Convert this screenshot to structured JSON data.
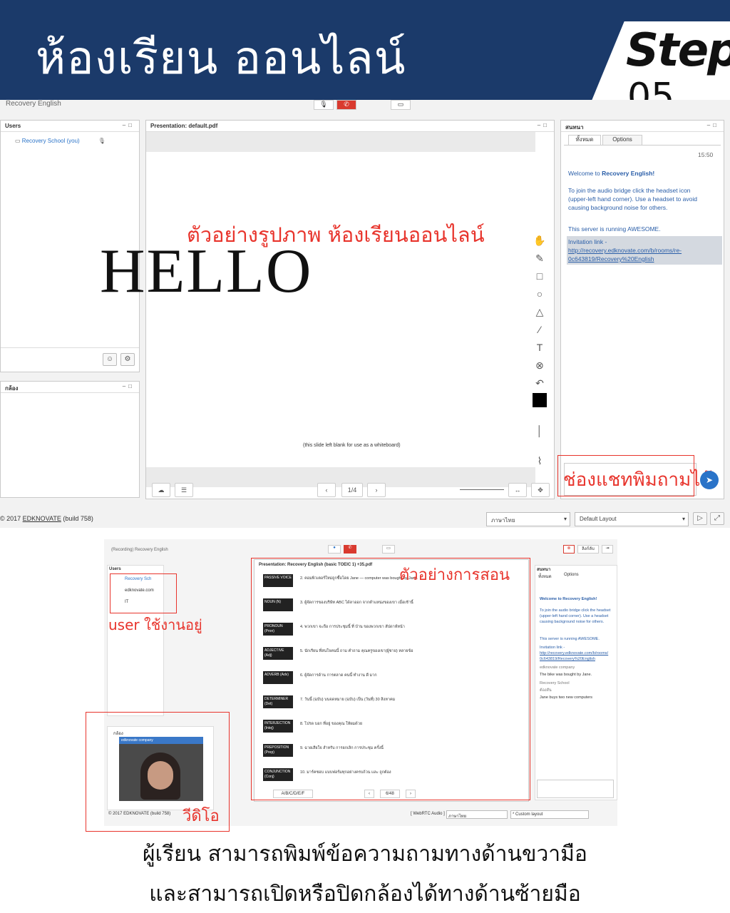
{
  "header": {
    "title": "ห้องเรียน ออนไลน์",
    "step_word": "Step",
    "step_number": "05"
  },
  "shot1": {
    "app_title": "Recovery English",
    "users_panel": {
      "title": "Users",
      "user": "Recovery School (you)"
    },
    "camera_panel": {
      "title": "กล้อง"
    },
    "presentation": {
      "title": "Presentation: default.pdf",
      "caption": "ตัวอย่างรูปภาพ  ห้องเรียนออนไลน์",
      "hello": "HELLO",
      "blank_note": "(this slide left blank for use as a whiteboard)",
      "page": "1/4"
    },
    "chat": {
      "title": "สนทนา",
      "tab_all": "ทั้งหมด",
      "tab_options": "Options",
      "time": "15:50",
      "welcome_prefix": "Welcome to ",
      "welcome_name": "Recovery English!",
      "info_1": "To join the audio bridge click the headset icon",
      "info_2": "(upper-left hand corner).  Use a headset to avoid",
      "info_3": "causing background noise for others.",
      "server": "This server is running AWESOME.",
      "invite_1": "Invitation link -",
      "invite_2": "http://recovery.edknovate.com/b/rooms/re-",
      "invite_3": "0c643819/Recovery%20English",
      "chat_caption": "ช่องแชทพิมถามได้"
    },
    "footer": {
      "copyright": "© 2017 ",
      "brand": "EDKNOVATE",
      "build": " (build 758)",
      "language": "ภาษาไทย",
      "layout": "Default Layout"
    }
  },
  "shot2": {
    "app_title": "(Recording) Recovery English",
    "end_label": "ลิงก์ลับ",
    "users_title": "Users",
    "user_1": "Recovery Sch",
    "user_2": "edknovate.com",
    "user_3": "IT",
    "user_caption": "user ใช้งานอยู่",
    "camera_title": "กล้อง",
    "video_label": "edknovate company",
    "video_caption": "วีดิโอ",
    "footer": "© 2017 EDKNOVATE (build 758)",
    "pres_title": "Presentation: Recovery English (basic TOEIC 1) +35.pdf",
    "teach_caption": "ตัวอย่างการสอน",
    "rows": [
      {
        "label": "PASSIVE VOICE",
        "text": "2. คอมพิวเตอร์ใหม่ถูกซื้อโดย Jane  — computer was bought by Jane."
      },
      {
        "label": "NOUN (N)",
        "text": "3. ผู้จัดการของบริษัท ABC ได้ลาออก จากตำแหน่งของเขา เมื่อเช้านี้"
      },
      {
        "label": "PRONOUN (Pron)",
        "text": "4. พวกเขา จะถือ การประชุมนี้ ที่ บ้าน ของพวกเขา สัปดาห์หน้า"
      },
      {
        "label": "ADJECTIVE (Adj)",
        "text": "5. นักเรียน ที่สนใจคนนี้ ถาม คำถาม คุณครูของเขา(ผู้ชาย) หลายข้อ"
      },
      {
        "label": "ADVERB (Adv)",
        "text": "6. ผู้จัดการด้าน การตลาด คนนี้ ทำงาน ดี มาก"
      },
      {
        "label": "DETERMINER (Det)",
        "text": "7. วันนี้ (ฉบับ) บนจดหมาย (ฉบับ) เป็น (วันที่) 30 สิงหาคม"
      },
      {
        "label": "INTERJECTION (Intej)",
        "text": "8. โปรด บอก ที่อยู่ ของคุณ ให้ผมด้วย"
      },
      {
        "label": "PREPOSITION (Prep)",
        "text": "9. ฉายเสียใจ สำหรับ การยกเลิก การประชุม ครั้งนี้"
      },
      {
        "label": "CONJUNCTION (Conj)",
        "text": "10. มาร์คชอบ แบบฟอร์มทุกอย่างครบถ้วน และ ถูกต้อง"
      }
    ],
    "page_label": "6/48",
    "abc_label": "A/B/C/D/E/F",
    "audio_label": "[ WebRTC Audio ]",
    "language": "ภาษาไทย",
    "layout": "* Custom layout",
    "chat": {
      "title": "สนทนา",
      "tab_all": "ทั้งหมด",
      "tab_options": "Options",
      "welcome": "Welcome to Recovery English!",
      "info_1": "To join the audio bridge click the headset",
      "info_2": "(upper-left hand corner).  Use a headset",
      "info_3": "causing background noise for others.",
      "server": "This server is running AWESOME.",
      "invite_1": "Invitation link -",
      "invite_2": "http://recovery.edknovate.com/b/rooms/",
      "invite_3": "0c643819/Recovery%20English",
      "msg_1_from": "edknovate company",
      "msg_1": "The bike was bought by Jane.",
      "msg_2_from": "Recovery School",
      "msg_2_time": "ต้องสัน",
      "msg_2": "Jane buys two new computers"
    }
  },
  "captions": {
    "line_1": "ผู้เรียน  สามารถพิมพ์ข้อความถามทางด้านขวามือ",
    "line_2": "และสามารถเปิดหรือปิดกล้องได้ทางด้านซ้ายมือ"
  },
  "colors": {
    "header_bg": "#1b3a6a",
    "accent_red": "#e8342c",
    "link_blue": "#2a73c8"
  }
}
